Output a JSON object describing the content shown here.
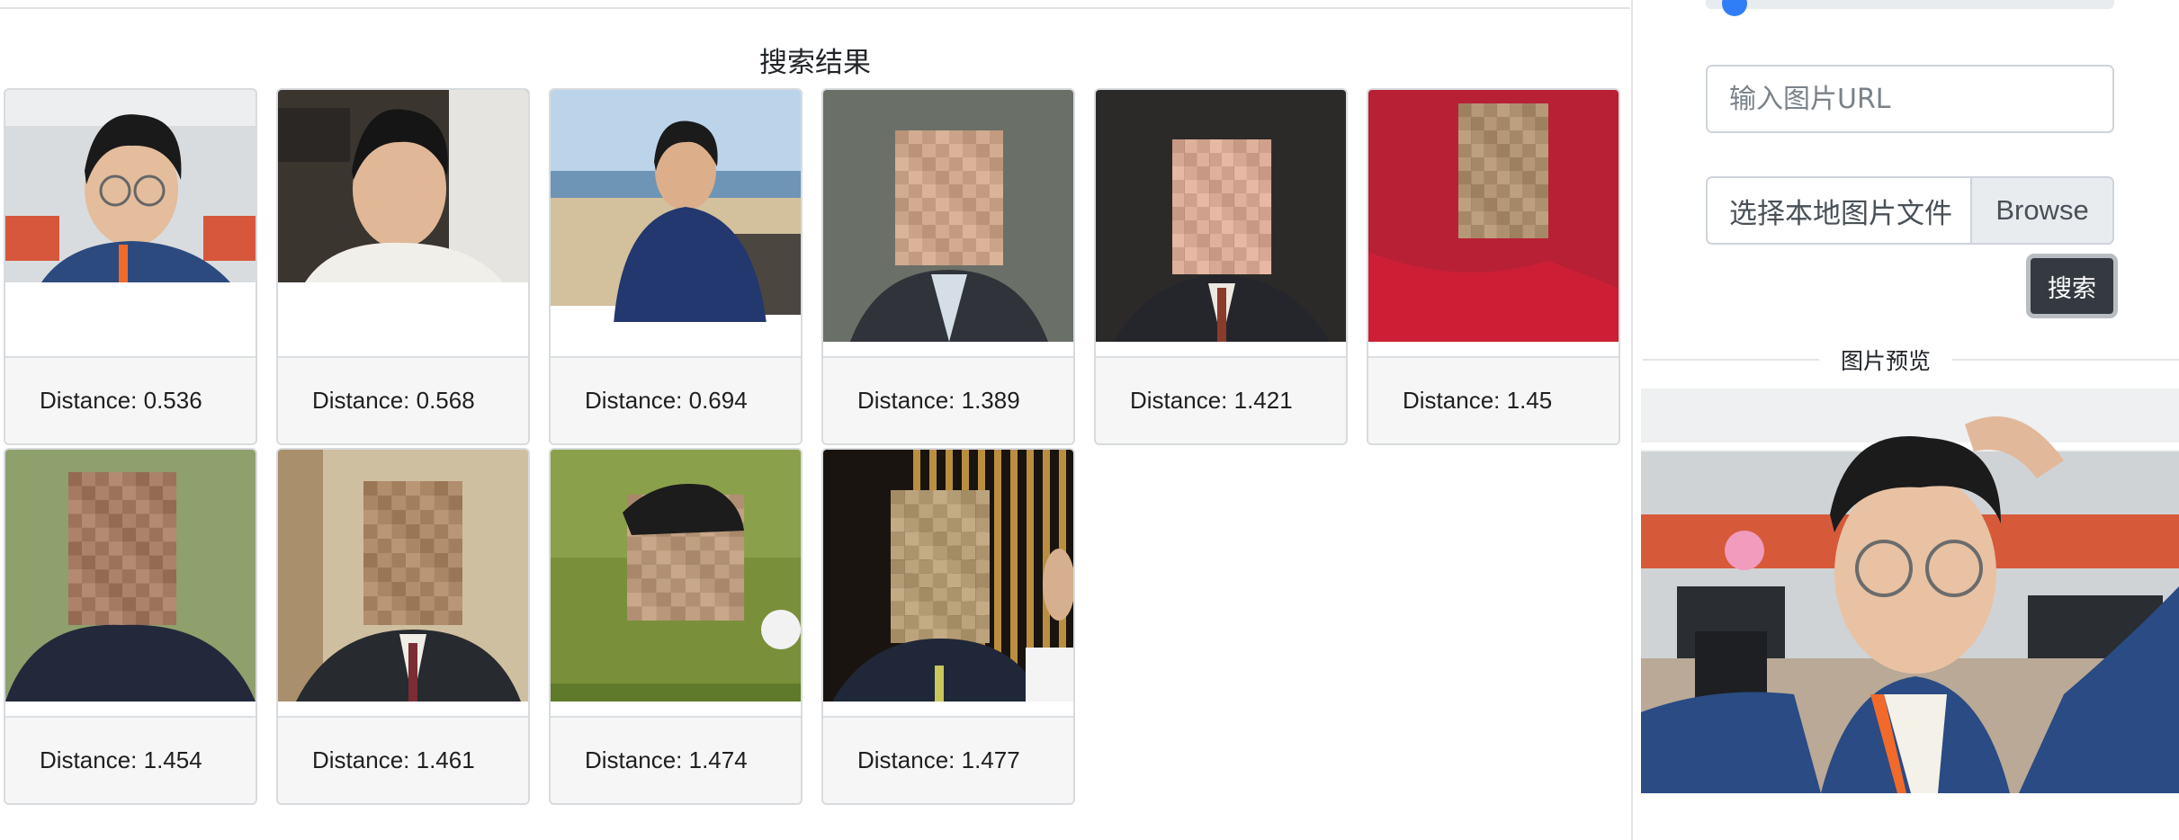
{
  "results": {
    "title": "搜索结果",
    "items": [
      {
        "distance_label": "Distance: 0.536",
        "image_kind": "selfie-office",
        "distance": 0.536
      },
      {
        "distance_label": "Distance: 0.568",
        "image_kind": "selfie-white-shirt",
        "distance": 0.568
      },
      {
        "distance_label": "Distance: 0.694",
        "image_kind": "beach-portrait",
        "distance": 0.694
      },
      {
        "distance_label": "Distance: 1.389",
        "image_kind": "pixelated-suit",
        "distance": 1.389
      },
      {
        "distance_label": "Distance: 1.421",
        "image_kind": "pixelated-suit-dark",
        "distance": 1.421
      },
      {
        "distance_label": "Distance: 1.45",
        "image_kind": "pixelated-red-jersey",
        "distance": 1.45
      },
      {
        "distance_label": "Distance: 1.454",
        "image_kind": "pixelated-cap-jacket",
        "distance": 1.454
      },
      {
        "distance_label": "Distance: 1.461",
        "image_kind": "pixelated-suit-beige",
        "distance": 1.461
      },
      {
        "distance_label": "Distance: 1.474",
        "image_kind": "pixelated-golfer",
        "distance": 1.474
      },
      {
        "distance_label": "Distance: 1.477",
        "image_kind": "pixelated-suit-stripes",
        "distance": 1.477
      }
    ]
  },
  "sidebar": {
    "url_placeholder": "输入图片URL",
    "file_label": "选择本地图片文件",
    "browse_label": "Browse",
    "search_button": "搜索",
    "preview_legend": "图片预览"
  },
  "colors": {
    "accent": "#2f7ef8",
    "search_button_bg": "#343a40",
    "card_footer_bg": "#f6f6f6"
  }
}
